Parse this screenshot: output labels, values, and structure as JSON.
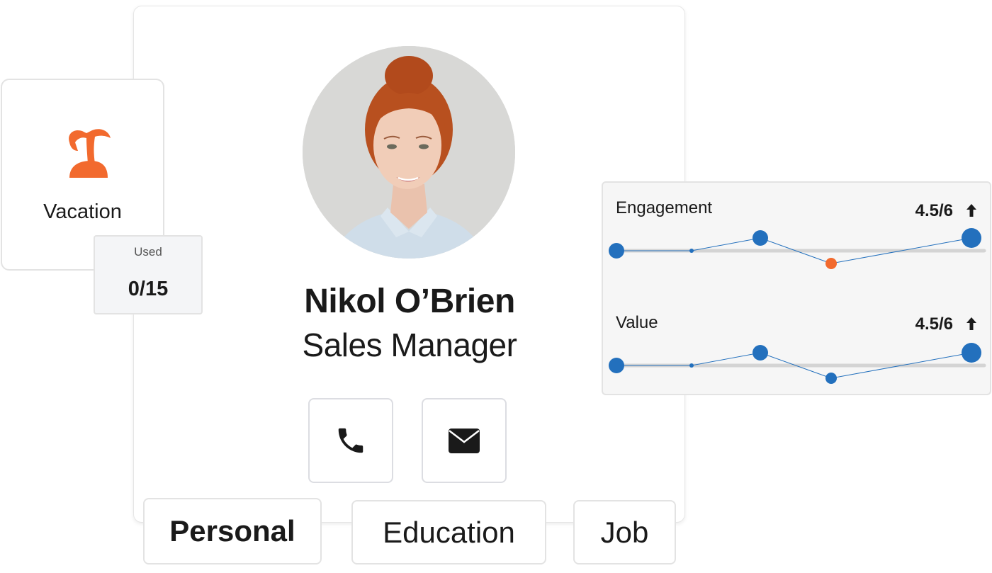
{
  "profile": {
    "name": "Nikol O’Brien",
    "role": "Sales Manager",
    "avatar_alt": "Profile photo of Nikol O’Brien"
  },
  "actions": {
    "phone_icon": "phone-icon",
    "email_icon": "envelope-icon"
  },
  "tabs": [
    {
      "label": "Personal",
      "active": true
    },
    {
      "label": "Education",
      "active": false
    },
    {
      "label": "Job",
      "active": false
    }
  ],
  "vacation": {
    "icon": "palm-tree-icon",
    "label": "Vacation",
    "used_label": "Used",
    "used_value": "0/15",
    "accent": "#f26a2e"
  },
  "metrics": [
    {
      "title": "Engagement",
      "score": "4.5/6",
      "trend": "up",
      "points": [
        {
          "value": 0,
          "color": "#2370bd",
          "size": "large"
        },
        {
          "value": 0,
          "color": "#2370bd",
          "size": "tiny"
        },
        {
          "value": 1,
          "color": "#2370bd",
          "size": "medium"
        },
        {
          "value": -1,
          "color": "#f26a2e",
          "size": "small"
        },
        {
          "value": 1,
          "color": "#2370bd",
          "size": "xlarge"
        }
      ]
    },
    {
      "title": "Value",
      "score": "4.5/6",
      "trend": "up",
      "points": [
        {
          "value": 0,
          "color": "#2370bd",
          "size": "large"
        },
        {
          "value": 0,
          "color": "#2370bd",
          "size": "tiny"
        },
        {
          "value": 1,
          "color": "#2370bd",
          "size": "medium"
        },
        {
          "value": -1,
          "color": "#2370bd",
          "size": "small"
        },
        {
          "value": 1,
          "color": "#2370bd",
          "size": "xlarge"
        }
      ]
    }
  ],
  "colors": {
    "primary": "#2370bd",
    "accent": "#f26a2e",
    "track": "#d4d4d4"
  }
}
